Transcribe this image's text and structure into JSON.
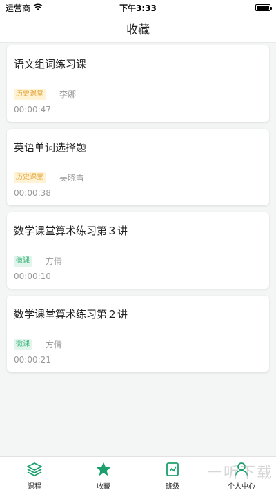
{
  "status_bar": {
    "carrier": "运营商",
    "time": "下午3:33"
  },
  "header": {
    "title": "收藏"
  },
  "courses": [
    {
      "title": "语文组词练习课",
      "tag": "历史课堂",
      "tag_type": "history",
      "teacher": "李娜",
      "duration": "00:00:47"
    },
    {
      "title": "英语单词选择题",
      "tag": "历史课堂",
      "tag_type": "history",
      "teacher": "吴晓雪",
      "duration": "00:00:38"
    },
    {
      "title": "数学课堂算术练习第３讲",
      "tag": "微课",
      "tag_type": "micro",
      "teacher": "方倩",
      "duration": "00:00:10"
    },
    {
      "title": "数学课堂算术练习第２讲",
      "tag": "微课",
      "tag_type": "micro",
      "teacher": "方倩",
      "duration": "00:00:21"
    }
  ],
  "tabs": [
    {
      "label": "课程",
      "icon": "layers-icon"
    },
    {
      "label": "收藏",
      "icon": "star-icon",
      "active": true
    },
    {
      "label": "班级",
      "icon": "class-icon"
    },
    {
      "label": "个人中心",
      "icon": "user-icon"
    }
  ],
  "watermark": "一听下载",
  "colors": {
    "accent": "#1aa06d",
    "history_tag_bg": "#fff3d6",
    "history_tag_text": "#e3a43a",
    "micro_tag_bg": "#e2f5ec",
    "micro_tag_text": "#3ab37a"
  }
}
